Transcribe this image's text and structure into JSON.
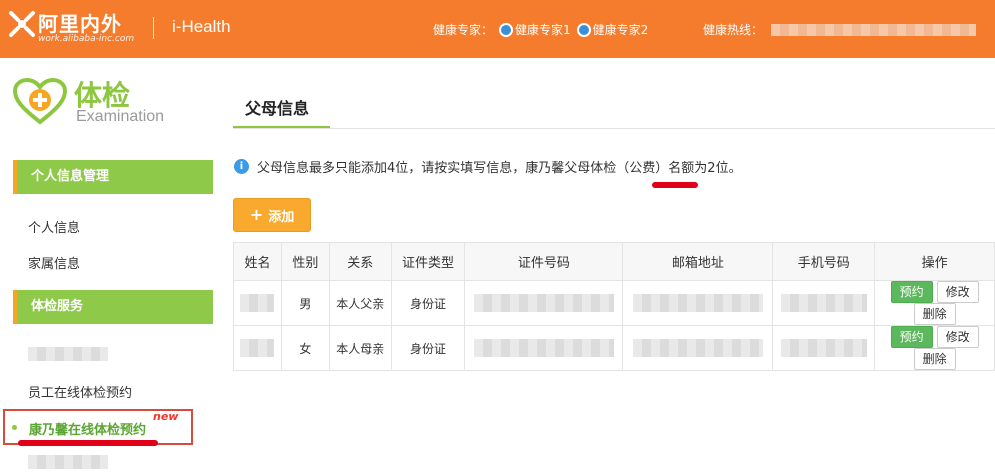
{
  "header": {
    "logo_cn": "阿里内外",
    "logo_en": "work.alibaba-inc.com",
    "app_name": "i-Health",
    "experts_label": "健康专家：",
    "expert1": "健康专家1",
    "expert2": "健康专家2",
    "hotline_label": "健康热线："
  },
  "brand": {
    "cn": "体检",
    "en": "Examination"
  },
  "sidebar": {
    "section1": "个人信息管理",
    "item_personal": "个人信息",
    "item_family": "家属信息",
    "section2": "体检服务",
    "item_employee_booking": "员工在线体检预约",
    "item_active": "康乃馨在线体检预约",
    "new_tag": "new"
  },
  "main": {
    "tab_title": "父母信息",
    "notice_before": "父母信息最多只能添加4位，请按实填写信息，康乃馨父母体检",
    "notice_highlight": "（公费）",
    "notice_after": "名额为2位。",
    "add_button": "添加",
    "columns": [
      "姓名",
      "性别",
      "关系",
      "证件类型",
      "证件号码",
      "邮箱地址",
      "手机号码",
      "操作"
    ],
    "rows": [
      {
        "gender": "男",
        "relation": "本人父亲",
        "id_type": "身份证"
      },
      {
        "gender": "女",
        "relation": "本人母亲",
        "id_type": "身份证"
      }
    ],
    "action_book": "预约",
    "action_edit": "修改",
    "action_delete": "删除"
  },
  "colors": {
    "header": "#f47c2c",
    "accent_green": "#8dc63f",
    "button_orange": "#f8a92e",
    "highlight_red": "#e1001a"
  }
}
